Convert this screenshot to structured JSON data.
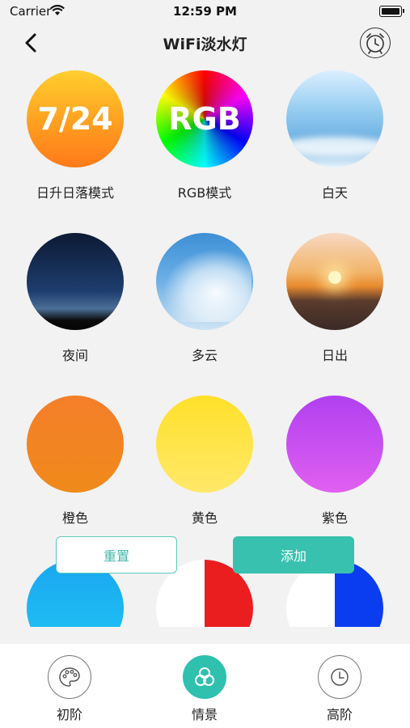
{
  "status_bar": {
    "carrier": "Carrier",
    "time": "12:59 PM"
  },
  "nav": {
    "title": "WiFi淡水灯"
  },
  "scenes": [
    {
      "label": "日升日落模式",
      "badge": "7/24",
      "icon": "sunrise-sunset-mode-icon"
    },
    {
      "label": "RGB模式",
      "badge": "RGB",
      "icon": "rgb-mode-icon"
    },
    {
      "label": "白天",
      "icon": "daytime-sky-image"
    },
    {
      "label": "夜间",
      "icon": "night-sky-image"
    },
    {
      "label": "多云",
      "icon": "cloudy-sky-image"
    },
    {
      "label": "日出",
      "icon": "sunrise-image"
    },
    {
      "label": "橙色",
      "color": "#f47e2a"
    },
    {
      "label": "黄色",
      "color": "#ffe02a"
    },
    {
      "label": "紫色",
      "color": "#b040f0"
    }
  ],
  "partial_row": [
    {
      "name": "blue",
      "color": "#1aa6f0"
    },
    {
      "name": "white-red",
      "colors": [
        "#ffffff",
        "#ea1e1e"
      ]
    },
    {
      "name": "white-blue",
      "colors": [
        "#ffffff",
        "#0a3df0"
      ]
    }
  ],
  "buttons": {
    "reset": "重置",
    "add": "添加"
  },
  "tabs": [
    {
      "label": "初阶",
      "icon": "palette-icon",
      "active": false
    },
    {
      "label": "情景",
      "icon": "scene-icon",
      "active": true
    },
    {
      "label": "高阶",
      "icon": "clock-icon",
      "active": false
    }
  ],
  "colors": {
    "accent": "#38c1af",
    "background": "#f2f2f2"
  }
}
